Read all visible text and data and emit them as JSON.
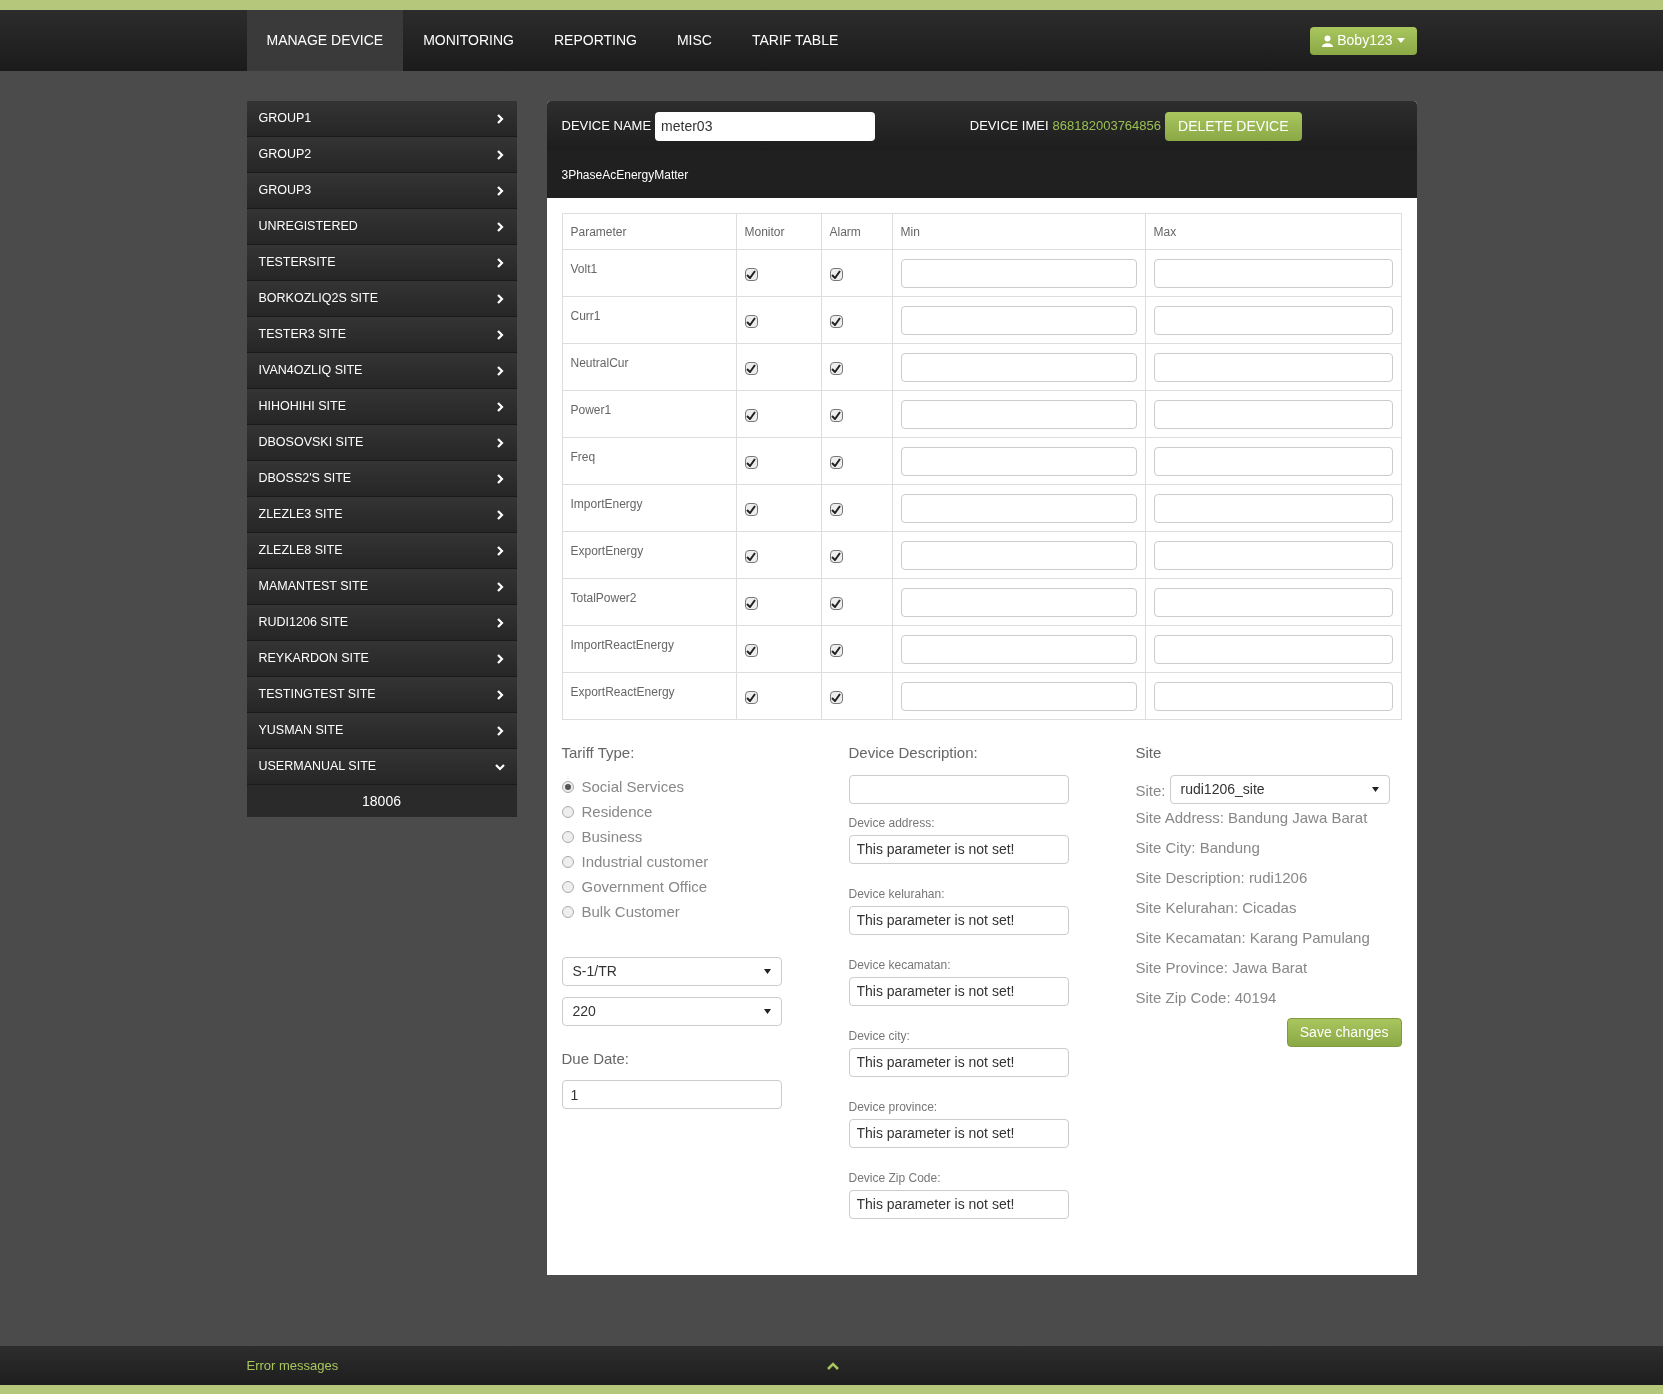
{
  "nav": {
    "tabs": [
      {
        "label": "MANAGE DEVICE",
        "selected": true
      },
      {
        "label": "MONITORING",
        "selected": false
      },
      {
        "label": "REPORTING",
        "selected": false
      },
      {
        "label": "MISC",
        "selected": false
      },
      {
        "label": "TARIF TABLE",
        "selected": false
      }
    ],
    "user_button": "Boby123"
  },
  "sidebar": {
    "items": [
      {
        "label": "GROUP1",
        "expanded": false
      },
      {
        "label": "GROUP2",
        "expanded": false
      },
      {
        "label": "GROUP3",
        "expanded": false
      },
      {
        "label": "UNREGISTERED",
        "expanded": false
      },
      {
        "label": "TESTERSITE",
        "expanded": false
      },
      {
        "label": "BORKOZLIQ2S SITE",
        "expanded": false
      },
      {
        "label": "TESTER3 SITE",
        "expanded": false
      },
      {
        "label": "IVAN4OZLIQ SITE",
        "expanded": false
      },
      {
        "label": "HIHOHIHI SITE",
        "expanded": false
      },
      {
        "label": "DBOSOVSKI SITE",
        "expanded": false
      },
      {
        "label": "DBOSS2'S SITE",
        "expanded": false
      },
      {
        "label": "ZLEZLE3 SITE",
        "expanded": false
      },
      {
        "label": "ZLEZLE8 SITE",
        "expanded": false
      },
      {
        "label": "MAMANTEST SITE",
        "expanded": false
      },
      {
        "label": "RUDI1206 SITE",
        "expanded": false
      },
      {
        "label": "REYKARDON SITE",
        "expanded": false
      },
      {
        "label": "TESTINGTEST SITE",
        "expanded": false
      },
      {
        "label": "YUSMAN SITE",
        "expanded": false
      },
      {
        "label": "USERMANUAL SITE",
        "expanded": true,
        "children": [
          {
            "label": "18006"
          }
        ]
      }
    ]
  },
  "device": {
    "name_label": "DEVICE NAME",
    "name_value": "meter03",
    "imei_label": "DEVICE IMEI",
    "imei_value": "868182003764856",
    "delete_button": "DELETE DEVICE",
    "type": "3PhaseAcEnergyMatter"
  },
  "table": {
    "columns": [
      "Parameter",
      "Monitor",
      "Alarm",
      "Min",
      "Max"
    ],
    "rows": [
      {
        "parameter": "Volt1",
        "monitor": true,
        "alarm": true
      },
      {
        "parameter": "Curr1",
        "monitor": true,
        "alarm": true
      },
      {
        "parameter": "NeutralCur",
        "monitor": true,
        "alarm": true
      },
      {
        "parameter": "Power1",
        "monitor": true,
        "alarm": true
      },
      {
        "parameter": "Freq",
        "monitor": true,
        "alarm": true
      },
      {
        "parameter": "ImportEnergy",
        "monitor": true,
        "alarm": true
      },
      {
        "parameter": "ExportEnergy",
        "monitor": true,
        "alarm": true
      },
      {
        "parameter": "TotalPower2",
        "monitor": true,
        "alarm": true
      },
      {
        "parameter": "ImportReactEnergy",
        "monitor": true,
        "alarm": true
      },
      {
        "parameter": "ExportReactEnergy",
        "monitor": true,
        "alarm": true
      }
    ]
  },
  "tariff": {
    "title": "Tariff Type:",
    "options": [
      {
        "label": "Social Services",
        "selected": true
      },
      {
        "label": "Residence",
        "selected": false
      },
      {
        "label": "Business",
        "selected": false
      },
      {
        "label": "Industrial customer",
        "selected": false
      },
      {
        "label": "Government Office",
        "selected": false
      },
      {
        "label": "Bulk Customer",
        "selected": false
      }
    ],
    "class_select": "S-1/TR",
    "power_select": "220",
    "due_date_label": "Due Date:",
    "due_date_value": "1"
  },
  "device_info": {
    "title": "Device Description:",
    "fields": [
      {
        "label": "Device address:",
        "value": "This parameter is not set!"
      },
      {
        "label": "Device kelurahan:",
        "value": "This parameter is not set!"
      },
      {
        "label": "Device kecamatan:",
        "value": "This parameter is not set!"
      },
      {
        "label": "Device city:",
        "value": "This parameter is not set!"
      },
      {
        "label": "Device province:",
        "value": "This parameter is not set!"
      },
      {
        "label": "Device Zip Code:",
        "value": "This parameter is not set!"
      }
    ]
  },
  "site": {
    "title": "Site",
    "select_label": "Site:",
    "select_value": "rudi1206_site",
    "details": [
      "Site Address: Bandung Jawa Barat",
      "Site City: Bandung",
      "Site Description: rudi1206",
      "Site Kelurahan: Cicadas",
      "Site Kecamatan: Karang Pamulang",
      "Site Province: Jawa Barat",
      "Site Zip Code: 40194"
    ],
    "save_button": "Save changes"
  },
  "footer": {
    "label": "Error messages"
  }
}
